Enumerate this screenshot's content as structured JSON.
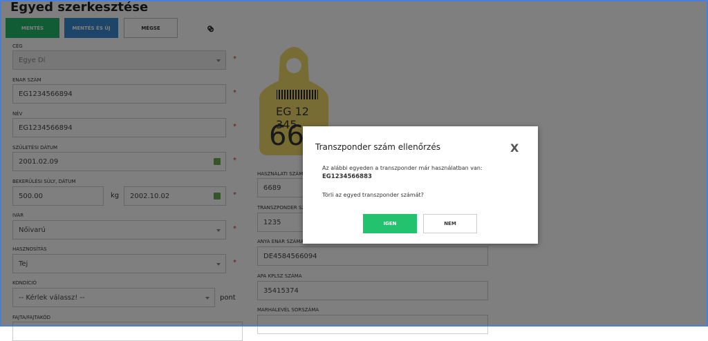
{
  "page": {
    "title": "Egyed szerkesztése"
  },
  "toolbar": {
    "save": "MENTÉS",
    "save_new": "MENTÉS ÉS ÚJ",
    "cancel": "MÉGSE"
  },
  "colors": {
    "green": "#22b96a",
    "blue": "#3a8ad4",
    "required": "#dd2222"
  },
  "form": {
    "ceg": {
      "label": "CÉG",
      "value": "Egye Dí"
    },
    "enar": {
      "label": "ENAR SZÁM",
      "value": "EG1234566894"
    },
    "nev": {
      "label": "NÉV",
      "value": "EG1234566894"
    },
    "szuletesi": {
      "label": "SZÜLETÉSI DÁTUM",
      "value": "2001.02.09"
    },
    "bekerulesi": {
      "label": "BEKERÜLÉSI SÚLY, DÁTUM",
      "weight": "500.00",
      "unit": "kg",
      "date": "2002.10.02"
    },
    "ivar": {
      "label": "IVAR",
      "value": "Nőivarú"
    },
    "hasznositas": {
      "label": "HASZNOSÍTÁS",
      "value": "Tej"
    },
    "kondicio": {
      "label": "KONDÍCIÓ",
      "value": "-- Kérlek válassz! --",
      "unit": "pont"
    },
    "fajta": {
      "label": "FAJTA/FAJTAKÓD"
    },
    "hasznalati": {
      "label": "HASZNÁLATI SZÁM",
      "value": "6689"
    },
    "transzponder": {
      "label": "TRANSZPONDER SZÁM",
      "value": "1235"
    },
    "anya": {
      "label": "ANYA ENAR SZÁMA",
      "value": "DE4584566094"
    },
    "apa": {
      "label": "APA KPLSZ SZÁMA",
      "value": "35415374"
    },
    "marhalevel": {
      "label": "MARHALEVÉL SORSZÁMA"
    }
  },
  "tag": {
    "code": "EG 12 345",
    "number": "66"
  },
  "modal": {
    "title": "Transzponder szám ellenőrzés",
    "close": "X",
    "message": "Az alábbi egyeden a transzponder már használatban van:",
    "id": "EG1234566883",
    "question": "Törli az egyed transzponder számát?",
    "yes": "IGEN",
    "no": "NEM"
  }
}
